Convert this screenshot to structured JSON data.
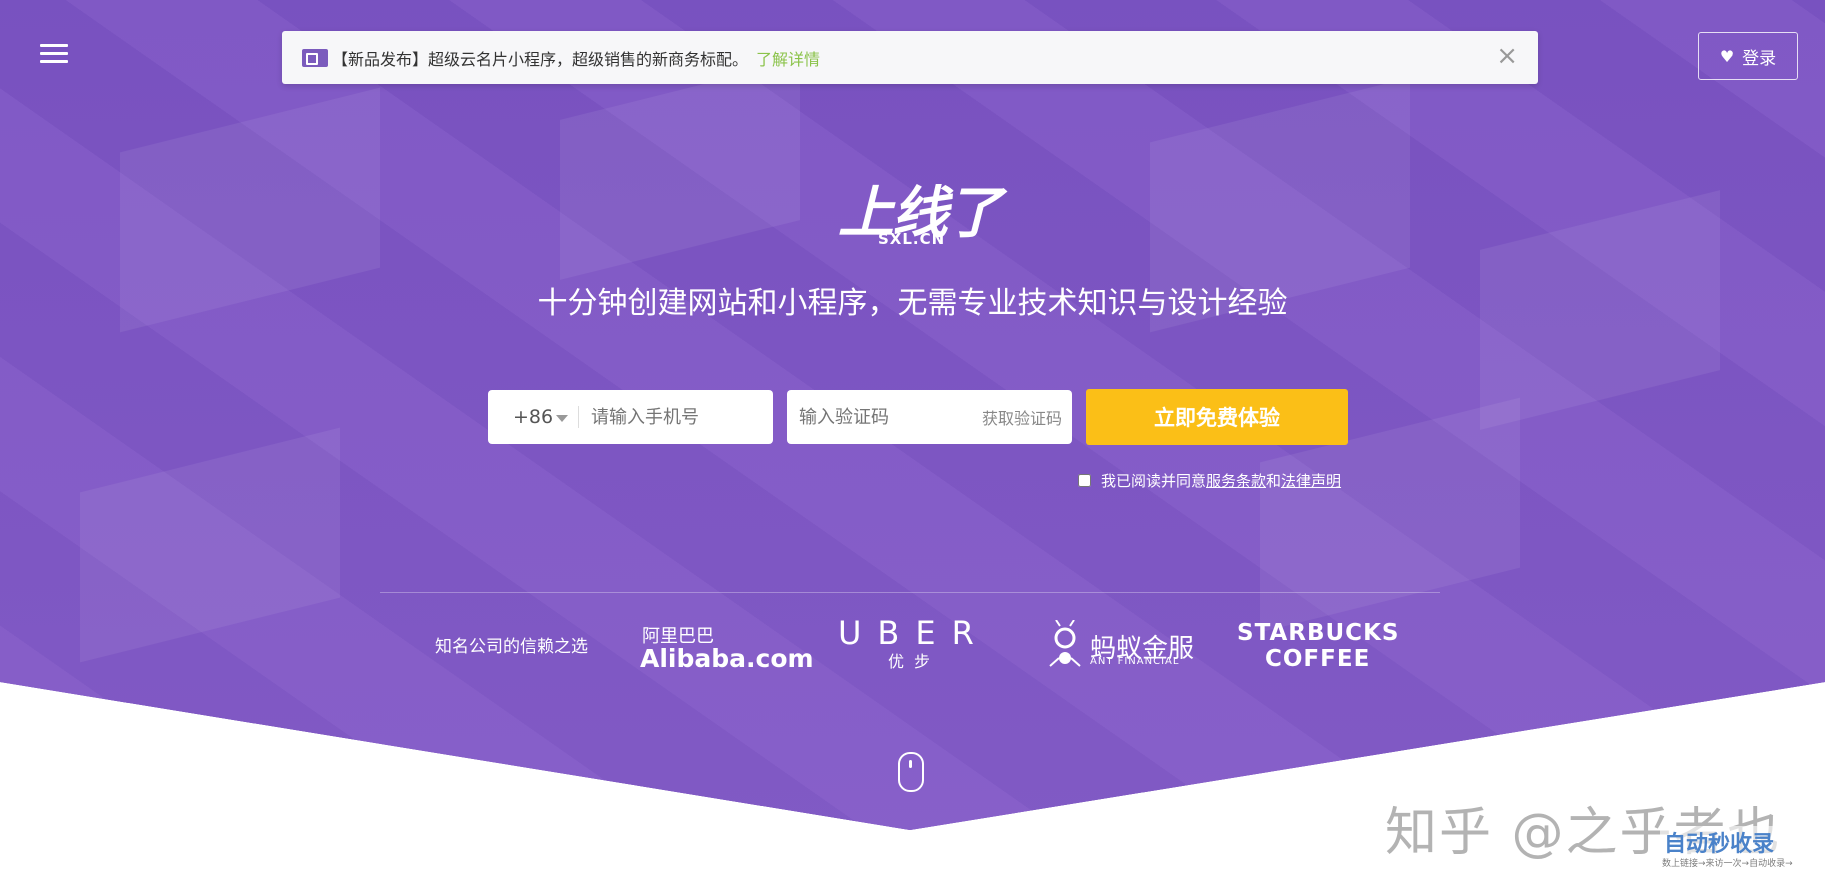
{
  "notice": {
    "tag": "【新品发布】",
    "text": "超级云名片小程序，超级销售的新商务标配。",
    "link": "了解详情",
    "close": "×"
  },
  "header": {
    "login_label": "登录"
  },
  "logo": {
    "main": "上线了",
    "sub": "SXL.CN"
  },
  "tagline": "十分钟创建网站和小程序，无需专业技术知识与设计经验",
  "form": {
    "country_code": "+86",
    "phone_placeholder": "请输入手机号",
    "code_placeholder": "输入验证码",
    "get_code": "获取验证码",
    "submit_label": "立即免费体验",
    "agree_text": "我已阅读并同意",
    "terms_link": "服务条款",
    "and_text": "和",
    "legal_link": "法律声明"
  },
  "trust": {
    "label": "知名公司的信赖之选",
    "brands": {
      "alibaba_cn": "阿里巴巴",
      "alibaba_en": "Alibaba.com",
      "uber_en": "UBER",
      "uber_cn": "优步",
      "ant_cn": "蚂蚁金服",
      "ant_en": "ANT FINANCIAL",
      "starbucks_1": "STARBUCKS",
      "starbucks_2": "COFFEE"
    }
  },
  "watermark": {
    "main": "知乎 @之乎者也",
    "logo": "自动秒收录",
    "small": "数上链接→来访一次→自动收录→"
  },
  "colors": {
    "hero_purple": "#7a55c0",
    "cta_yellow": "#fbbf17",
    "notice_link": "#8bc34a"
  }
}
